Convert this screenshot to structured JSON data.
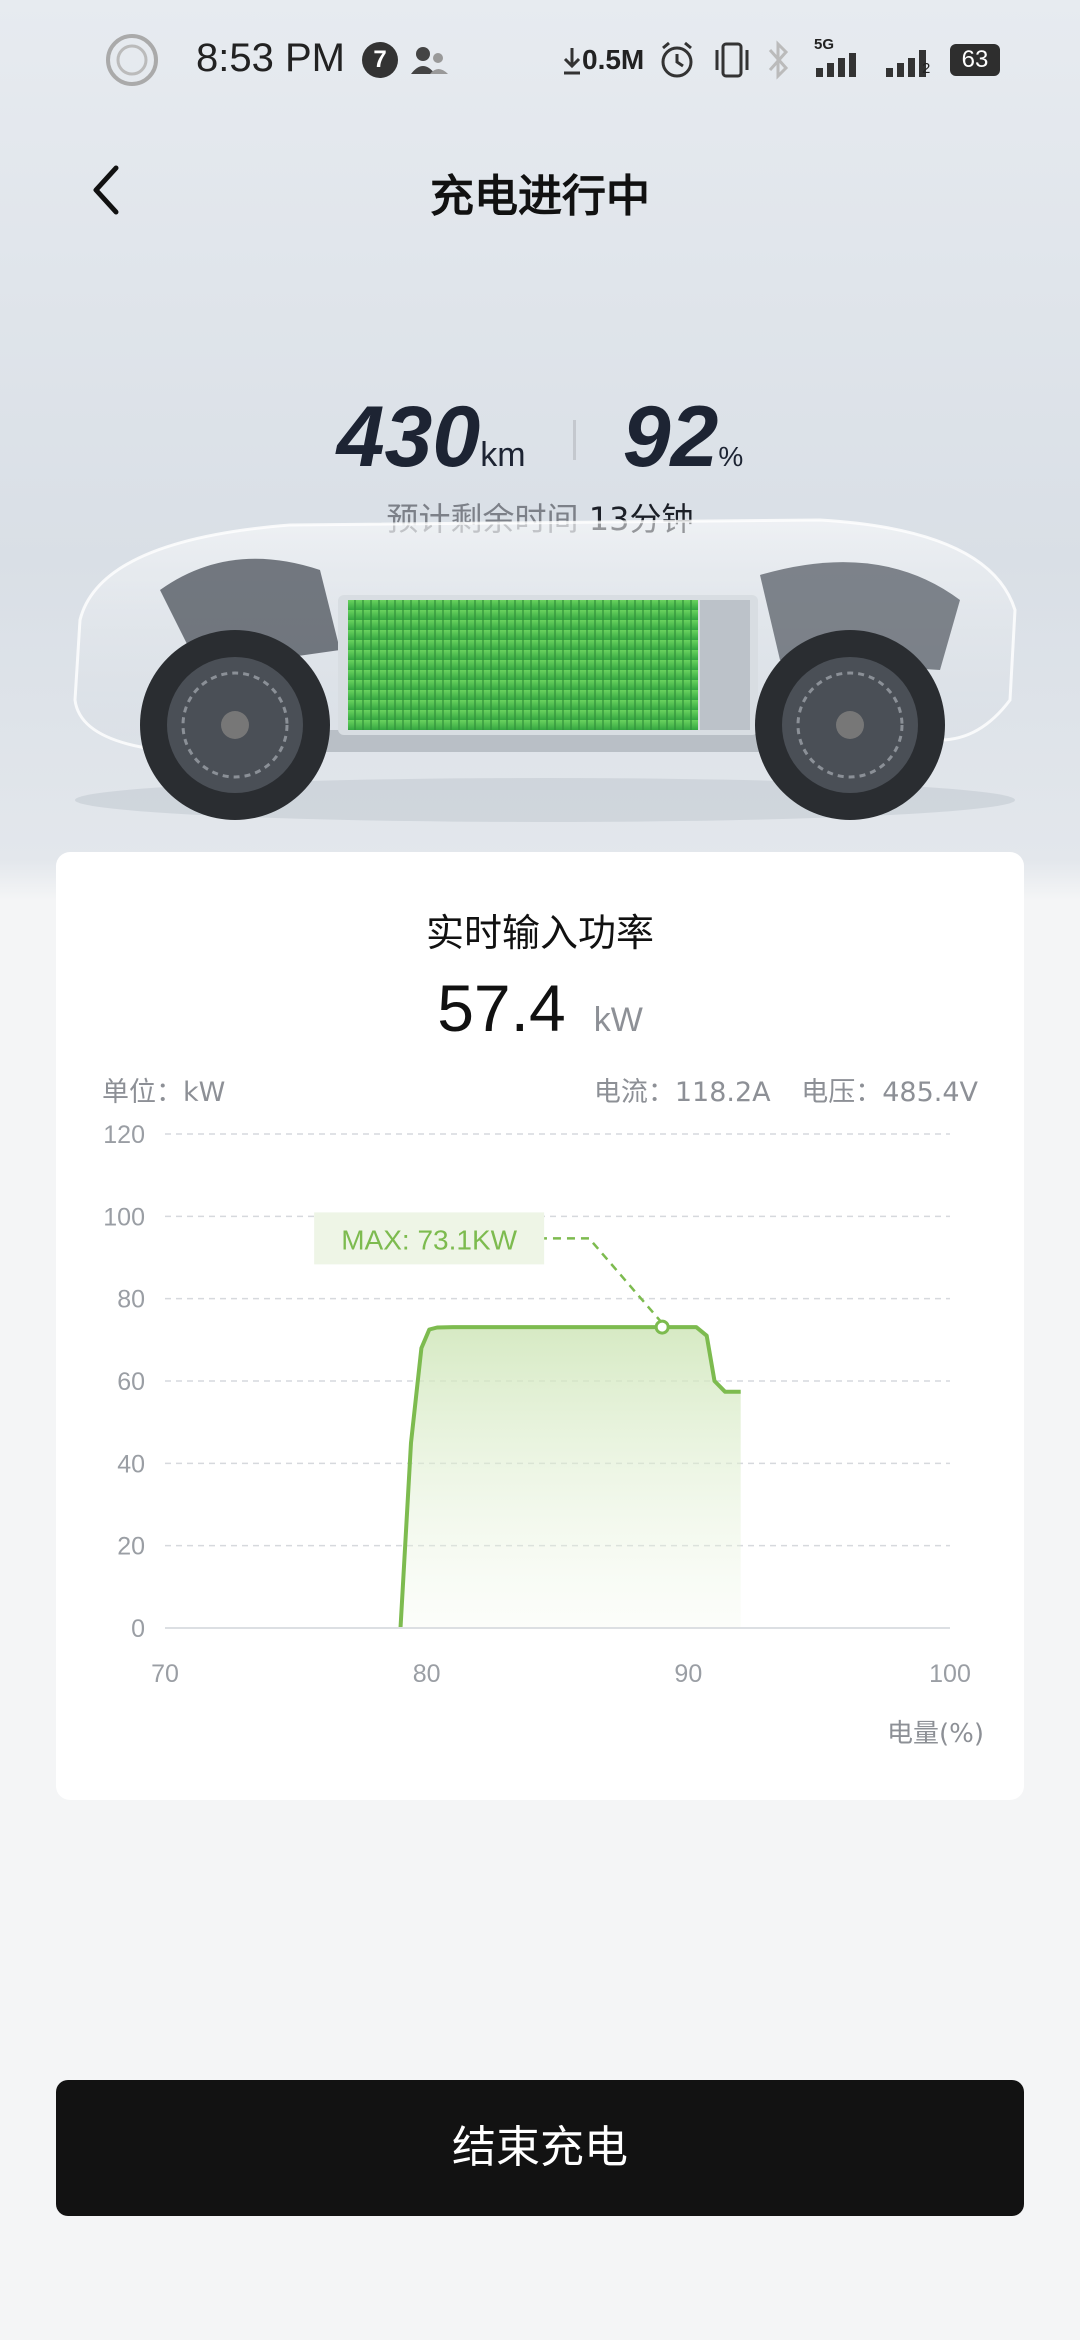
{
  "status_bar": {
    "time": "8:53 PM",
    "notification_count": "7",
    "net_speed": "0.5M",
    "network": "5G",
    "sim2": "2",
    "battery": "63"
  },
  "header": {
    "title": "充电进行中"
  },
  "summary": {
    "range_value": "430",
    "range_unit": "km",
    "soc_value": "92",
    "soc_unit": "%",
    "remaining_label": "预计剩余时间",
    "remaining_value": "13分钟"
  },
  "card": {
    "title": "实时输入功率",
    "power_value": "57.4",
    "power_unit": "kW",
    "unit_label": "单位：kW",
    "current_label": "电流：118.2A",
    "voltage_label": "电压：485.4V"
  },
  "chart_data": {
    "type": "area",
    "x": [
      79.0,
      79.4,
      79.8,
      80.1,
      80.4,
      81,
      83,
      86,
      89,
      90.3,
      90.7,
      91.0,
      91.4,
      92.0
    ],
    "y": [
      0,
      45,
      68,
      72.5,
      73.0,
      73.1,
      73.1,
      73.1,
      73.1,
      73.1,
      71,
      60,
      57.4,
      57.4
    ],
    "xlim": [
      70,
      100
    ],
    "ylim": [
      0,
      120
    ],
    "xticks": [
      70,
      80,
      90,
      100
    ],
    "yticks": [
      0,
      20,
      40,
      60,
      80,
      100,
      120
    ],
    "xlabel": "电量(%)",
    "ylabel": "",
    "grid": true,
    "max_point": {
      "x": 89,
      "y": 73.1,
      "label": "MAX: 73.1KW"
    },
    "color": "#7dbb4f"
  },
  "action": {
    "end_label": "结束充电"
  }
}
